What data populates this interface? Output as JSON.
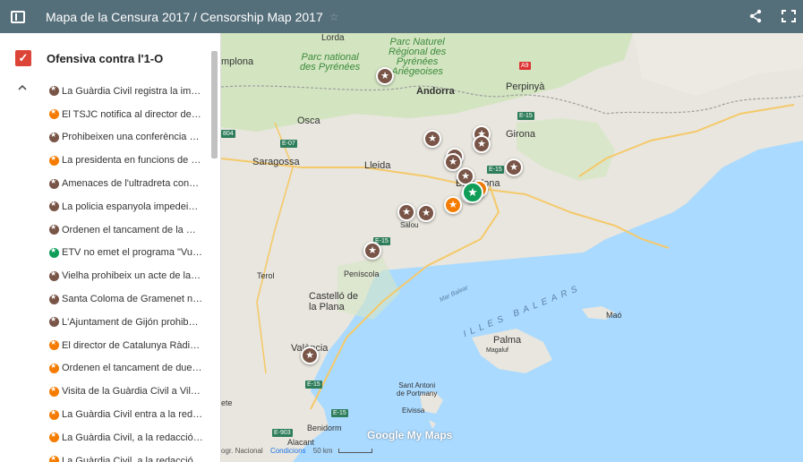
{
  "header": {
    "title": "Mapa de la Censura 2017 / Censorship Map 2017",
    "star_icon": "star-outline-icon",
    "share_icon": "share-icon",
    "fullscreen_icon": "fullscreen-icon"
  },
  "layer": {
    "title": "Ofensiva contra l'1-O",
    "checked": true
  },
  "items": [
    {
      "label": "La Guàrdia Civil registra la im…",
      "color": "#795548"
    },
    {
      "label": "El TSJC notifica al director de…",
      "color": "#f57c00"
    },
    {
      "label": "Prohibeixen una conferència …",
      "color": "#795548"
    },
    {
      "label": "La presidenta en funcions de …",
      "color": "#f57c00"
    },
    {
      "label": "Amenaces de l'ultradreta con…",
      "color": "#795548"
    },
    {
      "label": "La policia espanyola impedei…",
      "color": "#795548"
    },
    {
      "label": "Ordenen el tancament de la …",
      "color": "#795548"
    },
    {
      "label": "ETV no emet el programa \"Vu…",
      "color": "#0f9d58"
    },
    {
      "label": "Vielha prohibeix un acte de la…",
      "color": "#795548"
    },
    {
      "label": "Santa Coloma de Gramenet n…",
      "color": "#795548"
    },
    {
      "label": "L'Ajuntament de Gijón prohibe…",
      "color": "#795548"
    },
    {
      "label": "El director de Catalunya Ràdi…",
      "color": "#f57c00"
    },
    {
      "label": "Ordenen el tancament de due…",
      "color": "#f57c00"
    },
    {
      "label": "Visita de la Guàrdia Civil a Vil…",
      "color": "#f57c00"
    },
    {
      "label": "La Guàrdia Civil entra a la red…",
      "color": "#f57c00"
    },
    {
      "label": "La Guàrdia Civil, a la redacció…",
      "color": "#f57c00"
    },
    {
      "label": "La Guàrdia Civil, a la redacció…",
      "color": "#f57c00"
    }
  ],
  "map": {
    "labels": {
      "lorda": "Lorda",
      "pamplona": "mplona",
      "parc_nat": "Parc national\ndes Pyrénées",
      "parc_nat_pyr": "Parc Naturel\nRégional des\nPyrénées\nAriégeoises",
      "andorra": "Andorra",
      "perpinya": "Perpinyà",
      "osca": "Osca",
      "girona": "Girona",
      "saragossa": "Saragossa",
      "lleida": "Lleida",
      "barcelona": "Barcelona",
      "salou": "Salou",
      "teruel": "Terol",
      "peniscola": "Peníscola",
      "castello": "Castelló de\nla Plana",
      "mar_balear": "Mar Balear",
      "illes_balears": "ILLES BALEARS",
      "mao": "Maó",
      "palma": "Palma",
      "magaluf": "Magaluf",
      "valencia": "València",
      "sant_antoni": "Sant Antoni\nde Portmany",
      "eivissa": "Eivissa",
      "benidorm": "Benidorm",
      "alacant": "Alacant",
      "ete": "ete"
    },
    "shields": [
      "A9",
      "E-15",
      "E-07",
      "804",
      "E-15",
      "E-15",
      "E-15",
      "E-15",
      "E-903"
    ],
    "attribution": "ogr. Nacional",
    "conditions": "Condicions",
    "scale": "50 km",
    "logo": "Google My Maps",
    "marker_colors": {
      "brown": "#795548",
      "orange": "#f57c00",
      "green": "#0f9d58"
    }
  }
}
